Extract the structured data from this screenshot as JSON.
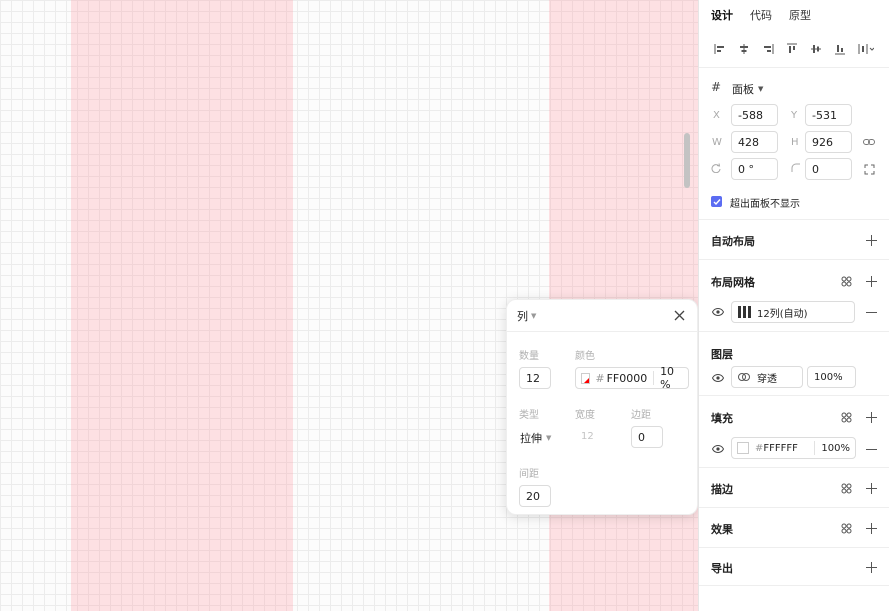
{
  "panel": {
    "tabs": [
      {
        "label": "设计",
        "active": true
      },
      {
        "label": "代码",
        "active": false
      },
      {
        "label": "原型",
        "active": false
      }
    ],
    "frame": {
      "label": "面板",
      "x_label": "X",
      "x_value": "-588",
      "y_label": "Y",
      "y_value": "-531",
      "w_label": "W",
      "w_value": "428",
      "h_label": "H",
      "h_value": "926",
      "rotation_value": "0 °",
      "radius_value": "0",
      "clip_label": "超出面板不显示",
      "clip_checked": true
    },
    "auto_layout": {
      "title": "自动布局"
    },
    "layout_grid": {
      "title": "布局网格",
      "value": "12列(自动)"
    },
    "layer": {
      "title": "图层",
      "blend": "穿透",
      "opacity": "100%"
    },
    "fill": {
      "title": "填充",
      "color": "FFFFFF",
      "opacity": "100%"
    },
    "stroke": {
      "title": "描边"
    },
    "effects": {
      "title": "效果"
    },
    "export": {
      "title": "导出"
    }
  },
  "popover": {
    "title": "列",
    "count_label": "数量",
    "count_value": "12",
    "color_label": "颜色",
    "color_hash": "#",
    "color_value": "FF0000",
    "color_opacity": "10 %",
    "type_label": "类型",
    "type_value": "拉伸",
    "width_label": "宽度",
    "width_value": "12",
    "margin_label": "边距",
    "margin_value": "0",
    "gutter_label": "间距",
    "gutter_value": "20"
  },
  "colors": {
    "accent": "#5b6cf2",
    "grid_column": "#ff9aa3",
    "checkbox": "#5b6cf2"
  }
}
